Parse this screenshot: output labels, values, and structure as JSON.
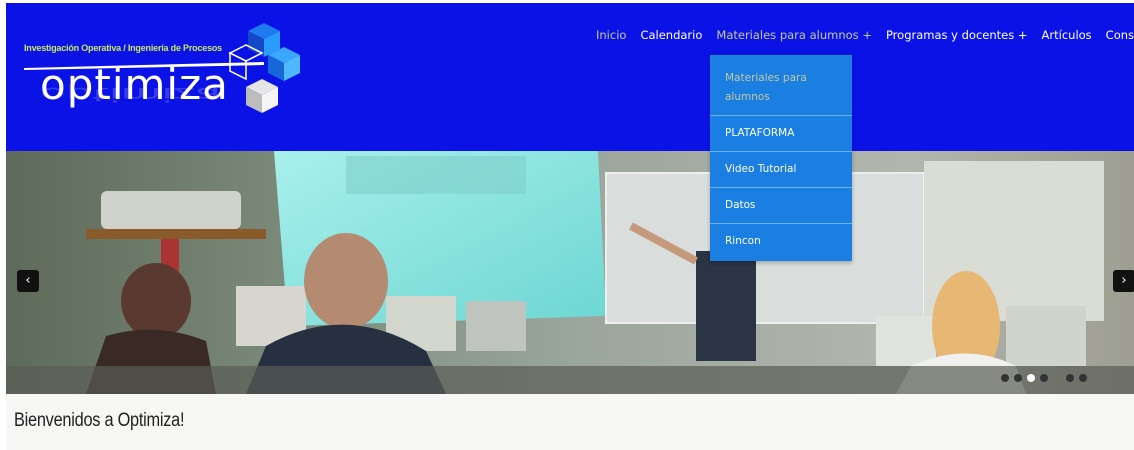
{
  "header": {
    "tagline": "Investigación Operativa / Ingeniería de Procesos",
    "logo_text": "optimiza",
    "background": "#0b12e6"
  },
  "nav": {
    "items": [
      {
        "label": "Inicio"
      },
      {
        "label": "Calendario"
      },
      {
        "label": "Materiales para alumnos +"
      },
      {
        "label": "Programas y docentes +"
      },
      {
        "label": "Artículos"
      },
      {
        "label": "Consultas"
      }
    ]
  },
  "dropdown": {
    "items": [
      {
        "label": "Materiales para alumnos"
      },
      {
        "label": "PLATAFORMA"
      },
      {
        "label": "Video Tutorial"
      },
      {
        "label": "Datos"
      },
      {
        "label": "Rincon"
      }
    ],
    "background": "#1a7fe0"
  },
  "slider": {
    "prev_glyph": "‹",
    "next_glyph": "›",
    "slide_count": 7,
    "active_slide": 3
  },
  "welcome": {
    "title": "Bienvenidos a Optimiza!"
  }
}
